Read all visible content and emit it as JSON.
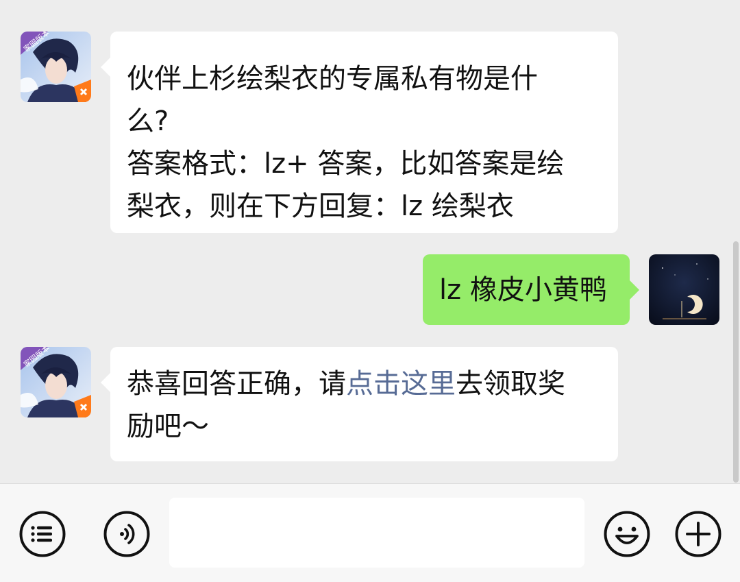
{
  "messages": [
    {
      "side": "left",
      "sender": "game-account",
      "lines": [
        "伙伴上杉绘梨衣的专属私有物是什",
        "么?",
        "答案格式：lz+ 答案，比如答案是绘",
        "梨衣，则在下方回复：lz 绘梨衣"
      ]
    },
    {
      "side": "right",
      "sender": "me",
      "text": "lz 橡皮小黄鸭"
    },
    {
      "side": "left",
      "sender": "game-account",
      "reply_prefix": "恭喜回答正确，请",
      "reply_link": "点击这里",
      "reply_suffix_line1": "去领取奖",
      "reply_line2": "励吧～"
    }
  ],
  "avatar_badge": "家园版本",
  "colors": {
    "background": "#ededed",
    "incoming_bubble": "#ffffff",
    "outgoing_bubble": "#95ec69",
    "link": "#576b95",
    "bottom_bar": "#f7f7f7"
  },
  "input": {
    "value": "",
    "placeholder": ""
  },
  "icons": [
    "list-menu-icon",
    "voice-icon",
    "emoji-icon",
    "plus-icon"
  ]
}
